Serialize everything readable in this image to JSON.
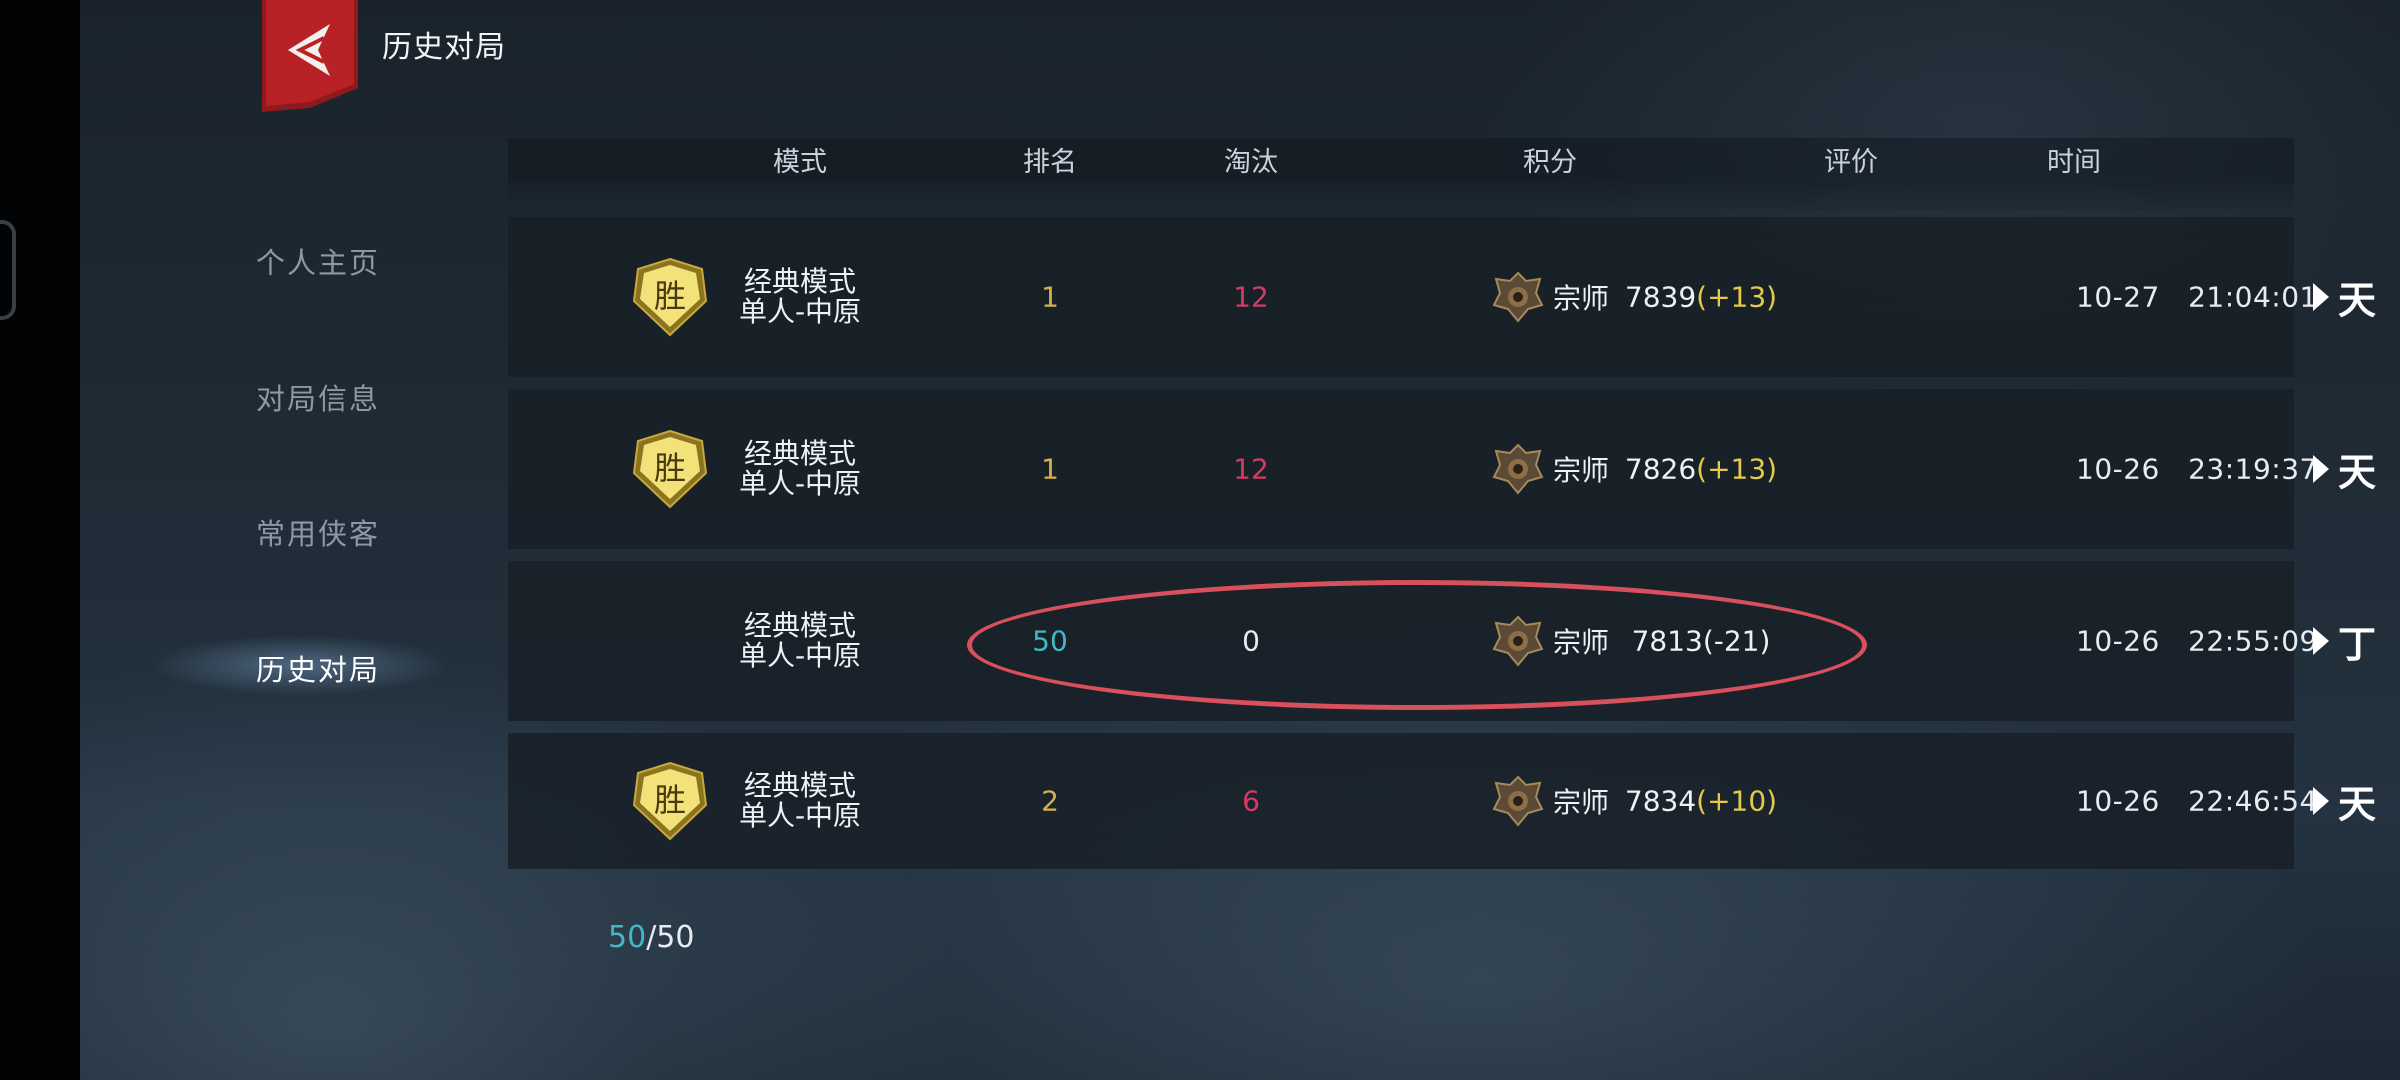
{
  "header": {
    "title": "历史对局",
    "back_icon": "chevron-left-icon"
  },
  "sidebar": {
    "items": [
      {
        "label": "个人主页",
        "active": false
      },
      {
        "label": "对局信息",
        "active": false
      },
      {
        "label": "常用侠客",
        "active": false
      },
      {
        "label": "历史对局",
        "active": true
      }
    ]
  },
  "table": {
    "columns": [
      "模式",
      "排名",
      "淘汰",
      "积分",
      "评价",
      "时间"
    ],
    "rows": [
      {
        "result": "胜",
        "mode_line1": "经典模式",
        "mode_line2": "单人-中原",
        "rank": "1",
        "kills": "12",
        "tier": "宗师",
        "score": "7839",
        "delta": "(+13)",
        "grade": "天",
        "date": "10-27",
        "time": "21:04:01"
      },
      {
        "result": "胜",
        "mode_line1": "经典模式",
        "mode_line2": "单人-中原",
        "rank": "1",
        "kills": "12",
        "tier": "宗师",
        "score": "7826",
        "delta": "(+13)",
        "grade": "天",
        "date": "10-26",
        "time": "23:19:37"
      },
      {
        "result": "",
        "mode_line1": "经典模式",
        "mode_line2": "单人-中原",
        "rank": "50",
        "kills": "0",
        "tier": "宗师",
        "score": "7813",
        "delta": "(-21)",
        "grade": "丁",
        "date": "10-26",
        "time": "22:55:09"
      },
      {
        "result": "胜",
        "mode_line1": "经典模式",
        "mode_line2": "单人-中原",
        "rank": "2",
        "kills": "6",
        "tier": "宗师",
        "score": "7834",
        "delta": "(+10)",
        "grade": "天",
        "date": "10-26",
        "time": "22:46:54"
      }
    ]
  },
  "pager": {
    "current": "50",
    "separator": "/",
    "total": "50"
  },
  "colors": {
    "gold": "#d7b04a",
    "kills_red": "#d63a63",
    "teal": "#45b7c4",
    "delta_yellow": "#e5c94a",
    "annotation_red": "#d8505c",
    "badge_red": "#b01f24"
  }
}
